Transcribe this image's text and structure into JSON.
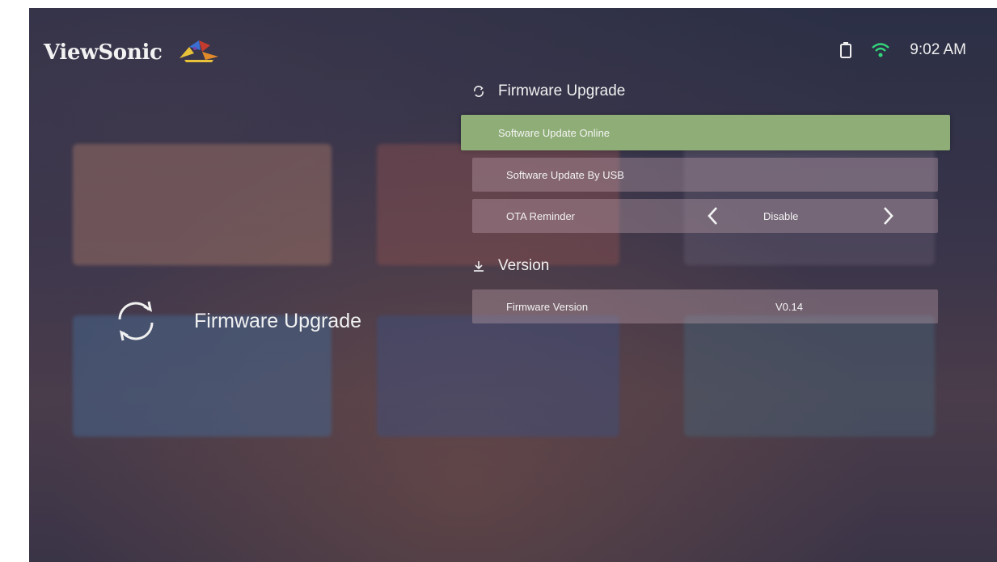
{
  "header": {
    "brand": "ViewSonic",
    "time": "9:02 AM"
  },
  "left_panel": {
    "title": "Firmware Upgrade"
  },
  "firmware_section": {
    "title": "Firmware Upgrade",
    "items": [
      {
        "label": "Software Update Online"
      },
      {
        "label": "Software Update By USB"
      },
      {
        "label": "OTA Reminder",
        "value": "Disable"
      }
    ]
  },
  "version_section": {
    "title": "Version",
    "items": [
      {
        "label": "Firmware Version",
        "value": "V0.14"
      }
    ]
  },
  "colors": {
    "selected_row": "#8fae77",
    "row_bg": "rgba(190,160,170,0.38)",
    "text": "#f3f3f3"
  },
  "icons": {
    "usb": "usb-drive-icon",
    "wifi": "wifi-icon",
    "refresh": "refresh-icon",
    "download": "download-icon",
    "chevron_left": "chevron-left-icon",
    "chevron_right": "chevron-right-icon"
  }
}
